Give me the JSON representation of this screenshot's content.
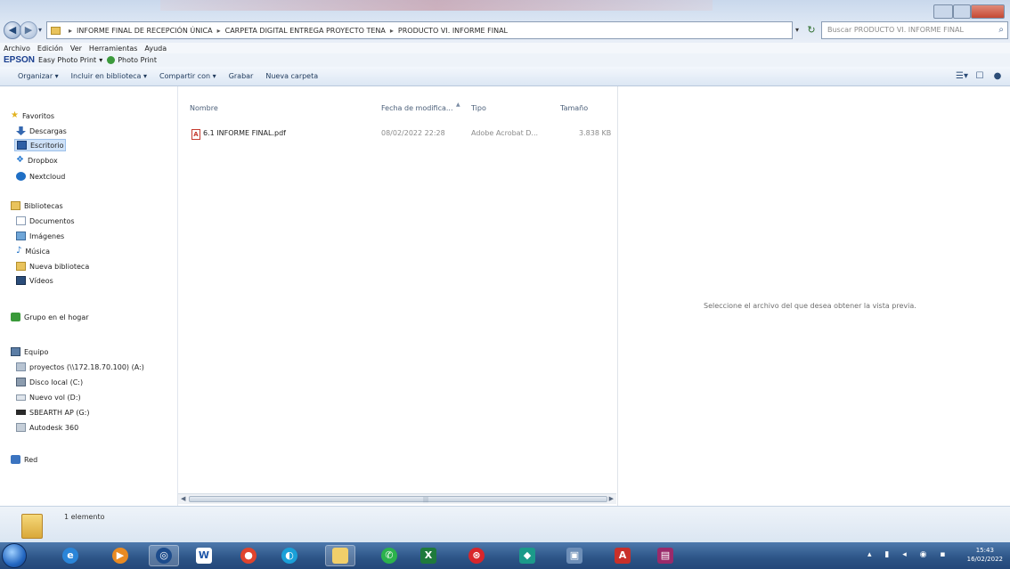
{
  "window": {
    "breadcrumb": [
      "INFORME FINAL DE RECEPCIÓN ÚNICA",
      "CARPETA DIGITAL ENTREGA PROYECTO TENA",
      "PRODUCTO VI. INFORME FINAL"
    ],
    "search_placeholder": "Buscar PRODUCTO VI. INFORME FINAL"
  },
  "menu": [
    "Archivo",
    "Edición",
    "Ver",
    "Herramientas",
    "Ayuda"
  ],
  "epson": {
    "brand": "EPSON",
    "easy_photo_print": "Easy Photo Print",
    "photo_print": "Photo Print"
  },
  "toolbar": {
    "organize": "Organizar ▾",
    "include_library": "Incluir en biblioteca ▾",
    "share_with": "Compartir con ▾",
    "burn": "Grabar",
    "new_folder": "Nueva carpeta"
  },
  "navpane": {
    "favorites": "Favoritos",
    "downloads": "Descargas",
    "desktop": "Escritorio",
    "dropbox": "Dropbox",
    "nextcloud": "Nextcloud",
    "libraries": "Bibliotecas",
    "documents": "Documentos",
    "images": "Imágenes",
    "music": "Música",
    "new_library": "Nueva biblioteca",
    "videos": "Vídeos",
    "homegroup": "Grupo en el hogar",
    "computer": "Equipo",
    "drive_proyectos": "proyectos (\\\\172.18.70.100) (A:)",
    "drive_c": "Disco local (C:)",
    "drive_d": "Nuevo vol (D:)",
    "drive_g": "SBEARTH AP (G:)",
    "autodesk": "Autodesk 360",
    "network": "Red"
  },
  "columns": {
    "name": "Nombre",
    "modified": "Fecha de modifica...",
    "type": "Tipo",
    "size": "Tamaño"
  },
  "files": [
    {
      "name": "6.1 INFORME FINAL.pdf",
      "modified": "08/02/2022 22:28",
      "type": "Adobe Acrobat D...",
      "size": "3.838 KB"
    }
  ],
  "preview_message": "Seleccione el archivo del que desea obtener la vista previa.",
  "status": {
    "count": "1 elemento"
  },
  "clock": {
    "time": "15:43",
    "date": "16/02/2022"
  },
  "colors": {
    "selection": "#cfe2f8",
    "taskbar": "#2c5486",
    "toolbar_text": "#1e395b"
  }
}
